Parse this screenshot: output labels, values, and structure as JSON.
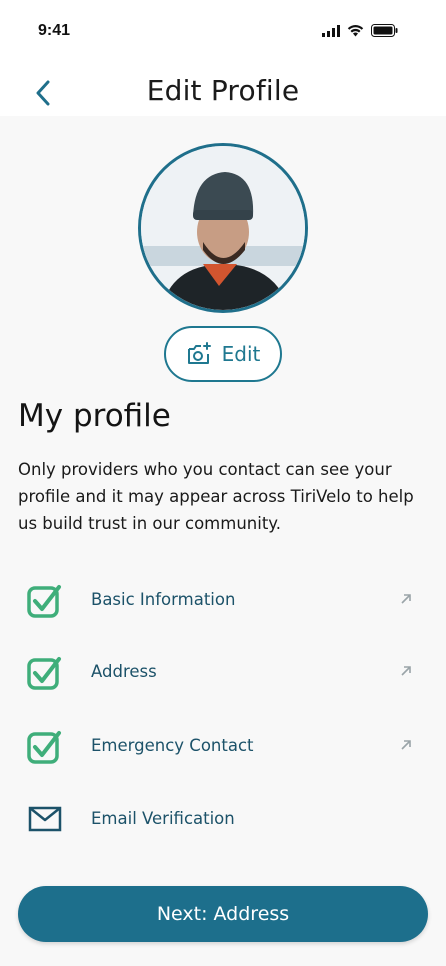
{
  "status_bar": {
    "time": "9:41"
  },
  "header": {
    "title": "Edit Profile"
  },
  "profile": {
    "edit_photo_label": "Edit"
  },
  "section": {
    "title": "My profile",
    "description": "Only providers who you contact can see your profile and it may appear across TiriVelo to help us build trust in our community."
  },
  "items": [
    {
      "label": "Basic Information",
      "icon": "checkbox-checked-icon",
      "completed": true
    },
    {
      "label": "Address",
      "icon": "checkbox-checked-icon",
      "completed": true
    },
    {
      "label": "Emergency Contact",
      "icon": "checkbox-checked-icon",
      "completed": true
    },
    {
      "label": "Email Verification",
      "icon": "mail-icon",
      "completed": false
    }
  ],
  "footer": {
    "next_label": "Next: Address"
  },
  "colors": {
    "primary": "#1d6f8c",
    "check_green": "#3fae7a",
    "label_teal": "#1c5269"
  }
}
